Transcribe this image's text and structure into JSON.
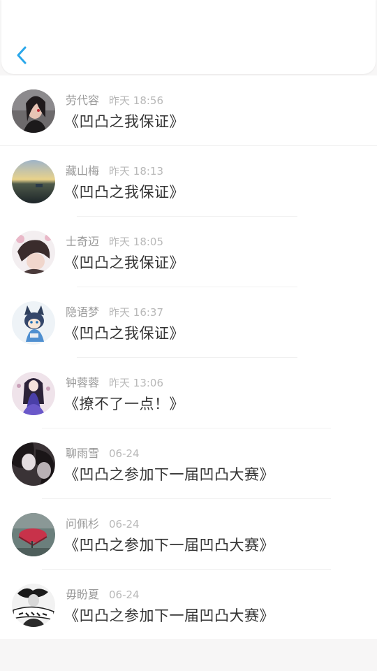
{
  "header": {
    "back_icon": "chevron-left-icon",
    "accent": "#2aa7ea"
  },
  "items": [
    {
      "name": "劳代容",
      "time": "昨天 18:56",
      "message": "《凹凸之我保证》"
    },
    {
      "name": "藏山梅",
      "time": "昨天 18:13",
      "message": "《凹凸之我保证》"
    },
    {
      "name": "士奇迈",
      "time": "昨天 18:05",
      "message": "《凹凸之我保证》"
    },
    {
      "name": "隐语梦",
      "time": "昨天 16:37",
      "message": "《凹凸之我保证》"
    },
    {
      "name": "钟蓉蓉",
      "time": "昨天 13:06",
      "message": "《撩不了一点！》"
    },
    {
      "name": "聊雨雪",
      "time": "06-24",
      "message": "《凹凸之参加下一届凹凸大赛》"
    },
    {
      "name": "问佩杉",
      "time": "06-24",
      "message": "《凹凸之参加下一届凹凸大赛》"
    },
    {
      "name": "毋盼夏",
      "time": "06-24",
      "message": "《凹凸之参加下一届凹凸大赛》"
    }
  ]
}
